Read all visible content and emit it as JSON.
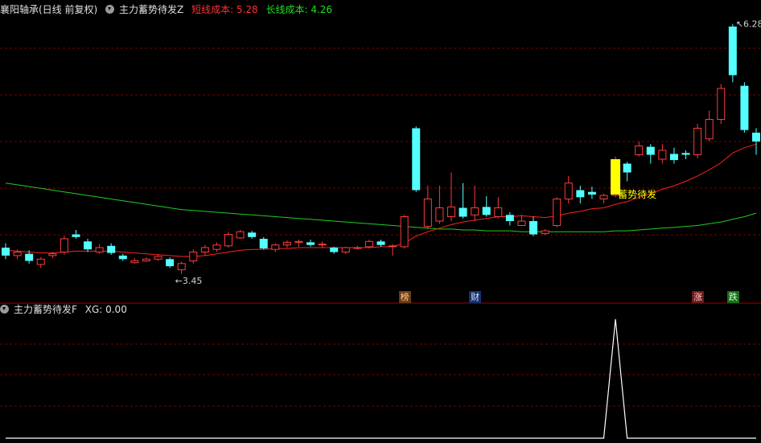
{
  "top_header": {
    "stock": "襄阳轴承(日线 前复权)",
    "indicator": "主力蓄势待发Z",
    "short_cost_label": "短线成本: 5.28",
    "long_cost_label": "长线成本: 4.26"
  },
  "bottom_header": {
    "indicator": "主力蓄势待发F",
    "xg_label": "XG: 0.00"
  },
  "colors": {
    "up": "#ff3b3b",
    "down": "#54ffff",
    "short_line": "#ff2020",
    "long_line": "#20cc20",
    "grid": "#7a0000",
    "signal": "#ffff00"
  },
  "annotations": {
    "high_label": "6.28",
    "low_label": "3.45",
    "signal_label": "蓄势待发"
  },
  "badges": [
    {
      "text": "榜",
      "bar_index": 34,
      "bg": "#6b3a1a",
      "fg": "#ffcc88"
    },
    {
      "text": "财",
      "bar_index": 40,
      "bg": "#1a2f6b",
      "fg": "#cce0ff"
    },
    {
      "text": "涨",
      "bar_index": 59,
      "bg": "#6b1a1a",
      "fg": "#ffcccc"
    },
    {
      "text": "跌",
      "bar_index": 62,
      "bg": "#1a6b1a",
      "fg": "#ccffcc"
    }
  ],
  "chart_data": {
    "type": "candlestick",
    "price_range": [
      3.35,
      6.35
    ],
    "candles": [
      [
        3.75,
        3.66,
        3.8,
        3.62
      ],
      [
        3.66,
        3.7,
        3.73,
        3.62
      ],
      [
        3.68,
        3.6,
        3.72,
        3.57
      ],
      [
        3.56,
        3.62,
        3.64,
        3.52
      ],
      [
        3.66,
        3.68,
        3.7,
        3.63
      ],
      [
        3.7,
        3.85,
        3.88,
        3.67
      ],
      [
        3.9,
        3.87,
        3.95,
        3.85
      ],
      [
        3.82,
        3.73,
        3.85,
        3.7
      ],
      [
        3.7,
        3.75,
        3.79,
        3.68
      ],
      [
        3.77,
        3.69,
        3.8,
        3.67
      ],
      [
        3.66,
        3.62,
        3.68,
        3.6
      ],
      [
        3.58,
        3.6,
        3.63,
        3.57
      ],
      [
        3.6,
        3.62,
        3.64,
        3.59
      ],
      [
        3.62,
        3.65,
        3.67,
        3.6
      ],
      [
        3.62,
        3.54,
        3.64,
        3.52
      ],
      [
        3.5,
        3.57,
        3.59,
        3.45
      ],
      [
        3.6,
        3.7,
        3.73,
        3.57
      ],
      [
        3.7,
        3.75,
        3.78,
        3.66
      ],
      [
        3.73,
        3.78,
        3.81,
        3.7
      ],
      [
        3.77,
        3.9,
        3.93,
        3.75
      ],
      [
        3.86,
        3.93,
        3.95,
        3.85
      ],
      [
        3.92,
        3.87,
        3.94,
        3.85
      ],
      [
        3.85,
        3.74,
        3.87,
        3.73
      ],
      [
        3.73,
        3.78,
        3.8,
        3.7
      ],
      [
        3.78,
        3.81,
        3.83,
        3.75
      ],
      [
        3.81,
        3.82,
        3.84,
        3.76
      ],
      [
        3.81,
        3.78,
        3.84,
        3.76
      ],
      [
        3.78,
        3.79,
        3.82,
        3.75
      ],
      [
        3.75,
        3.7,
        3.76,
        3.68
      ],
      [
        3.7,
        3.75,
        3.76,
        3.68
      ],
      [
        3.75,
        3.75,
        3.77,
        3.73
      ],
      [
        3.76,
        3.82,
        3.84,
        3.74
      ],
      [
        3.82,
        3.78,
        3.84,
        3.76
      ],
      [
        3.77,
        3.77,
        3.79,
        3.66
      ],
      [
        3.76,
        4.1,
        4.12,
        3.74
      ],
      [
        5.1,
        4.4,
        5.12,
        4.38
      ],
      [
        3.99,
        4.3,
        4.45,
        3.96
      ],
      [
        4.05,
        4.2,
        4.45,
        4.02
      ],
      [
        4.1,
        4.21,
        4.6,
        4.05
      ],
      [
        4.2,
        4.1,
        4.48,
        4.08
      ],
      [
        4.12,
        4.2,
        4.45,
        4.05
      ],
      [
        4.21,
        4.12,
        4.33,
        4.1
      ],
      [
        4.1,
        4.2,
        4.32,
        4.08
      ],
      [
        4.12,
        4.05,
        4.15,
        4.0
      ],
      [
        4.0,
        4.05,
        4.12,
        4.0
      ],
      [
        4.05,
        3.9,
        4.1,
        3.88
      ],
      [
        3.91,
        3.94,
        3.96,
        3.89
      ],
      [
        4.0,
        4.3,
        4.32,
        3.98
      ],
      [
        4.3,
        4.48,
        4.56,
        4.25
      ],
      [
        4.4,
        4.32,
        4.45,
        4.25
      ],
      [
        4.38,
        4.35,
        4.44,
        4.3
      ],
      [
        4.3,
        4.34,
        4.36,
        4.25
      ],
      [
        4.34,
        4.7,
        4.78,
        4.32
      ],
      [
        4.7,
        4.6,
        4.72,
        4.5
      ],
      [
        4.8,
        4.9,
        4.95,
        4.78
      ],
      [
        4.89,
        4.8,
        4.92,
        4.7
      ],
      [
        4.75,
        4.85,
        4.92,
        4.7
      ],
      [
        4.81,
        4.74,
        4.88,
        4.7
      ],
      [
        4.82,
        4.8,
        4.85,
        4.75
      ],
      [
        4.8,
        5.1,
        5.15,
        4.76
      ],
      [
        4.98,
        5.2,
        5.3,
        4.95
      ],
      [
        5.2,
        5.55,
        5.6,
        5.15
      ],
      [
        6.25,
        5.7,
        6.28,
        5.62
      ],
      [
        5.58,
        5.08,
        5.62,
        5.05
      ],
      [
        5.05,
        4.95,
        5.1,
        4.8
      ]
    ],
    "short_cost_ma": [
      3.72,
      3.71,
      3.7,
      3.69,
      3.69,
      3.7,
      3.71,
      3.71,
      3.71,
      3.71,
      3.7,
      3.69,
      3.68,
      3.67,
      3.66,
      3.65,
      3.65,
      3.66,
      3.68,
      3.7,
      3.72,
      3.73,
      3.73,
      3.74,
      3.74,
      3.75,
      3.75,
      3.75,
      3.75,
      3.75,
      3.75,
      3.75,
      3.76,
      3.76,
      3.8,
      3.88,
      3.93,
      3.97,
      4.01,
      4.04,
      4.06,
      4.08,
      4.1,
      4.1,
      4.11,
      4.1,
      4.09,
      4.11,
      4.14,
      4.16,
      4.19,
      4.2,
      4.24,
      4.27,
      4.32,
      4.36,
      4.41,
      4.45,
      4.5,
      4.56,
      4.63,
      4.71,
      4.82,
      4.88,
      4.92
    ],
    "long_cost_ma": [
      4.48,
      4.46,
      4.44,
      4.42,
      4.4,
      4.38,
      4.36,
      4.34,
      4.32,
      4.3,
      4.28,
      4.26,
      4.24,
      4.22,
      4.2,
      4.18,
      4.17,
      4.16,
      4.15,
      4.14,
      4.13,
      4.12,
      4.11,
      4.1,
      4.09,
      4.08,
      4.07,
      4.06,
      4.05,
      4.04,
      4.03,
      4.02,
      4.01,
      4.0,
      3.99,
      3.98,
      3.97,
      3.96,
      3.96,
      3.95,
      3.95,
      3.94,
      3.94,
      3.94,
      3.93,
      3.93,
      3.93,
      3.93,
      3.93,
      3.93,
      3.93,
      3.93,
      3.94,
      3.94,
      3.95,
      3.96,
      3.97,
      3.98,
      3.99,
      4.0,
      4.02,
      4.04,
      4.07,
      4.1,
      4.14
    ],
    "signal_bar_index": 52,
    "xg_values_nonzero": {
      "52": 1
    }
  }
}
